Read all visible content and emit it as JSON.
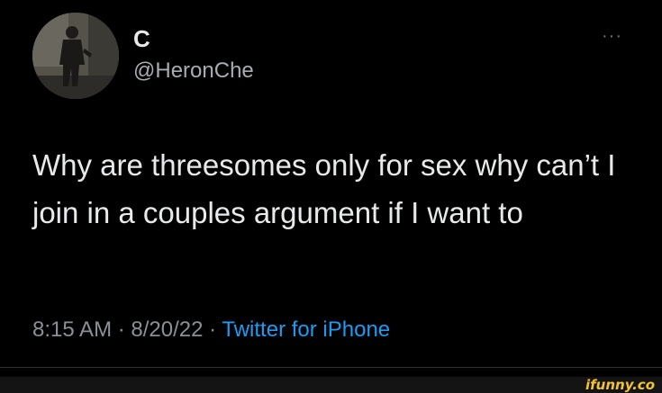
{
  "author": {
    "display_name": "C",
    "handle": "@HeronChe"
  },
  "tweet": {
    "text": "Why are threesomes only for sex why can’t I join in a couples argument if I want to",
    "time": "8:15 AM",
    "date": "8/20/22",
    "separator": "·",
    "source": "Twitter for iPhone"
  },
  "menu": {
    "more_label": "···"
  },
  "watermark": {
    "text": "ifunny.co"
  },
  "colors": {
    "background": "#000000",
    "text": "#e7e9ea",
    "secondary_text": "#8b9096",
    "link": "#1d9bf0",
    "watermark": "#f4c430"
  },
  "icons": {
    "avatar": "user-avatar-photo",
    "more": "more-options-icon"
  }
}
